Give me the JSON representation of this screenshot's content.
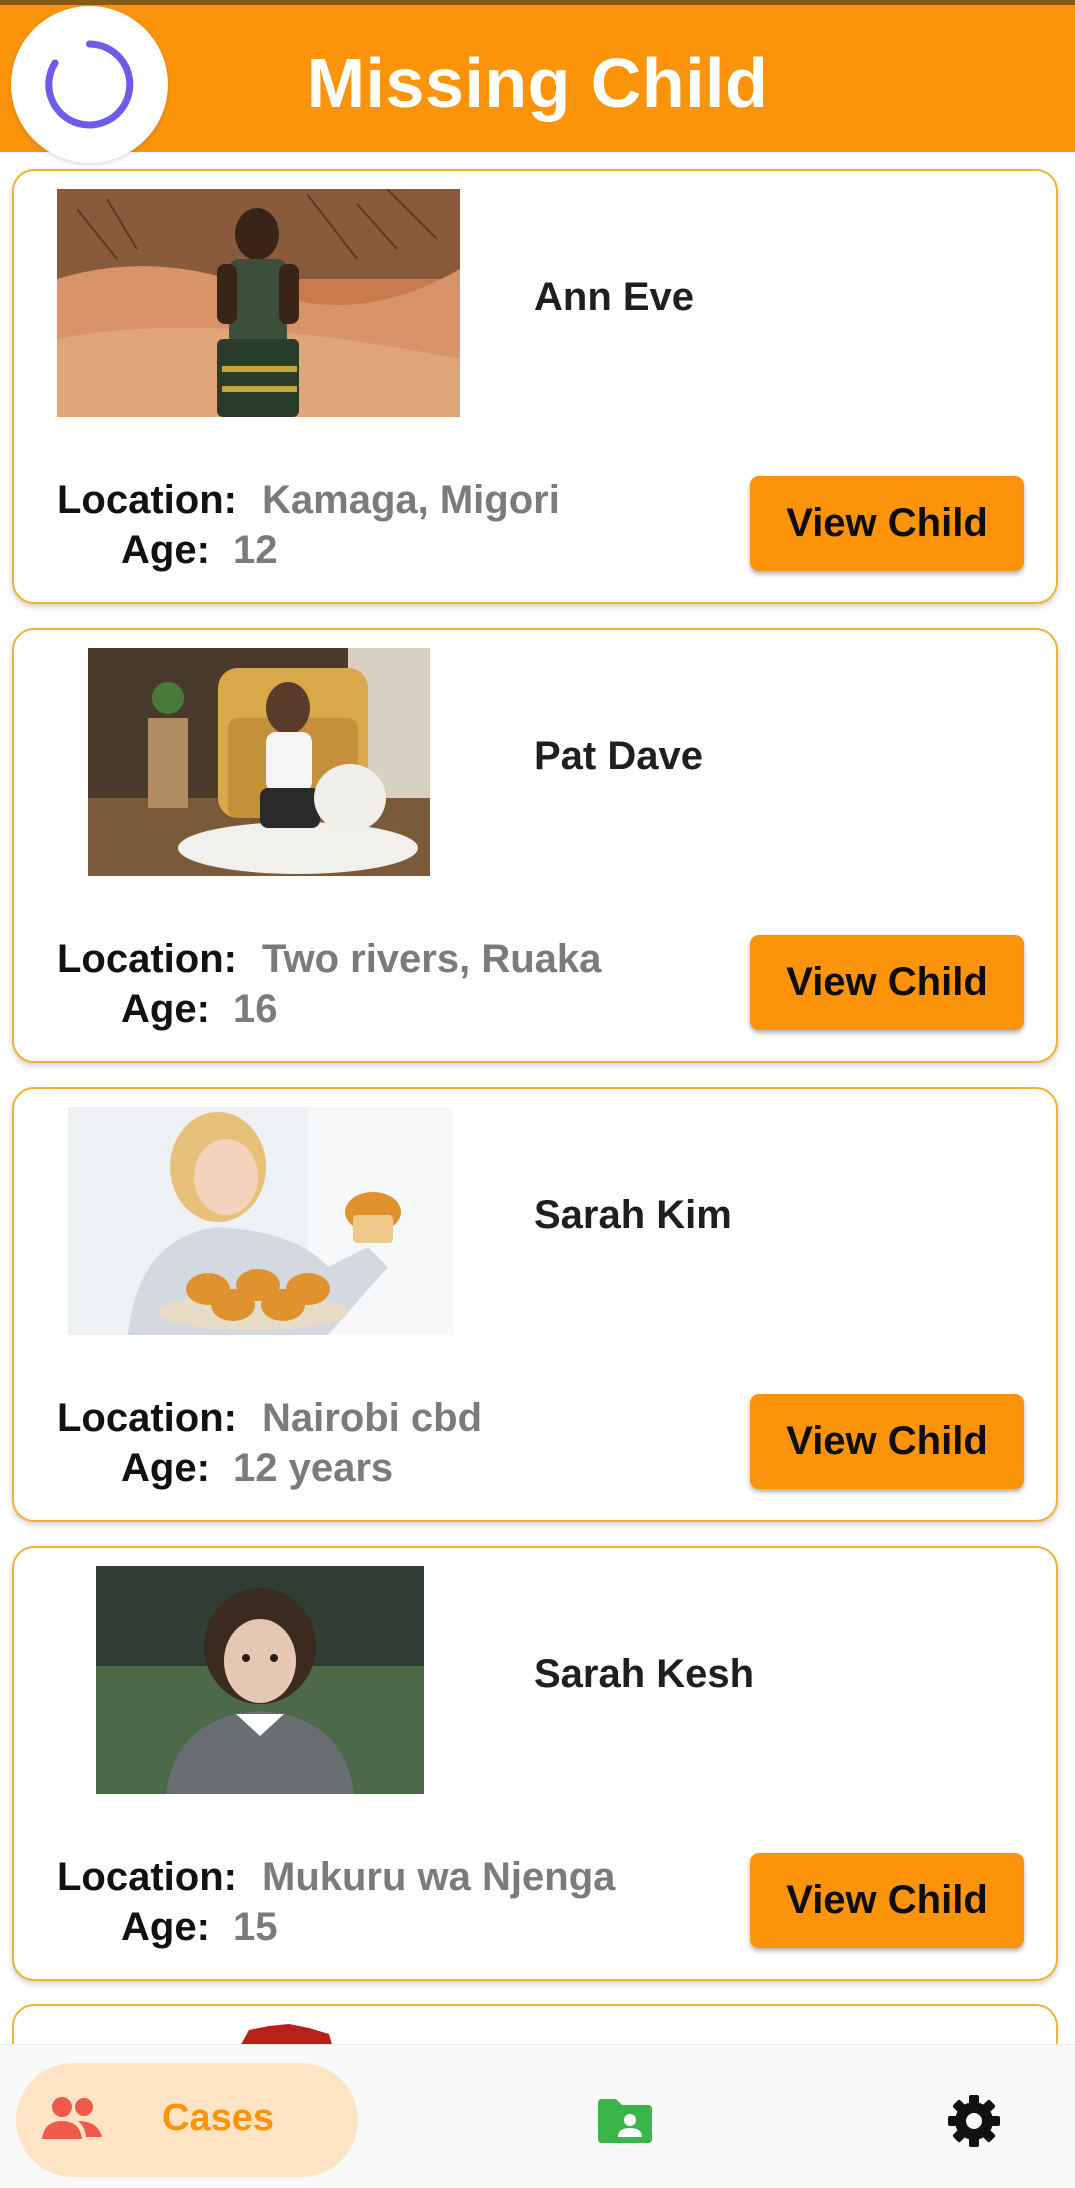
{
  "app": {
    "title": "Missing Child",
    "colors": {
      "accent": "#fc940b",
      "border": "#f2b234",
      "spinner": "#6c5ce7",
      "folder_green": "#3bb54a",
      "people_red": "#f05a4a"
    }
  },
  "cards": [
    {
      "name": "Ann Eve",
      "location_label": "Location:",
      "location": "Kamaga, Migori",
      "age_label": "Age:",
      "age": "12",
      "button": "View Child"
    },
    {
      "name": "Pat Dave",
      "location_label": "Location:",
      "location": "Two rivers, Ruaka",
      "age_label": "Age:",
      "age": "16",
      "button": "View Child"
    },
    {
      "name": "Sarah Kim",
      "location_label": "Location:",
      "location": "Nairobi cbd",
      "age_label": "Age:",
      "age": "12 years",
      "button": "View Child"
    },
    {
      "name": "Sarah Kesh",
      "location_label": "Location:",
      "location": "Mukuru wa Njenga",
      "age_label": "Age:",
      "age": "15",
      "button": "View Child"
    }
  ],
  "bottom_nav": {
    "items": [
      {
        "label": "Cases",
        "icon": "people-icon",
        "selected": true
      },
      {
        "icon": "folder-person-icon"
      },
      {
        "icon": "gear-icon"
      }
    ]
  }
}
